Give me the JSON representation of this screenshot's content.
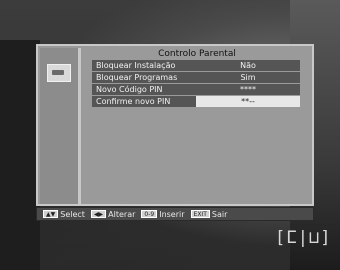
{
  "panel": {
    "title": "Controlo Parental"
  },
  "menu": {
    "rows": [
      {
        "label": "Bloquear Instalação",
        "value": "Não"
      },
      {
        "label": "Bloquear Programas",
        "value": "Sim"
      },
      {
        "label": "Novo Código PIN",
        "value": "****"
      },
      {
        "label": "Confirme novo PIN",
        "value": "**--"
      }
    ]
  },
  "help": {
    "select_key": "▲▼",
    "select_label": "Select",
    "alter_key": "◀▶",
    "alter_label": "Alterar",
    "insert_key": "0-9",
    "insert_label": "Inserir",
    "exit_key": "EXIT",
    "exit_label": "Sair"
  },
  "background": {
    "logo_text": "[ⵎ|⊔]"
  }
}
